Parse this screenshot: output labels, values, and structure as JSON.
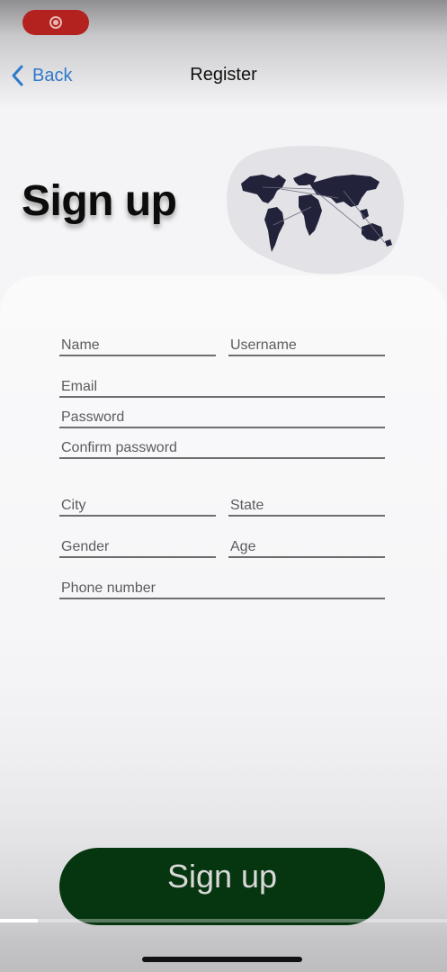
{
  "status": {
    "recording_icon": "screen-record-icon",
    "pill_color": "#b3221f"
  },
  "nav": {
    "back_label": "Back",
    "back_icon": "chevron-left-icon",
    "title": "Register",
    "accent": "#2f79c9"
  },
  "hero": {
    "title": "Sign up",
    "illustration": "world-map-illustration"
  },
  "form": {
    "name_placeholder": "Name",
    "username_placeholder": "Username",
    "email_placeholder": "Email",
    "password_placeholder": "Password",
    "confirm_password_placeholder": "Confirm password",
    "city_placeholder": "City",
    "state_placeholder": "State",
    "gender_placeholder": "Gender",
    "age_placeholder": "Age",
    "phone_placeholder": "Phone number"
  },
  "submit": {
    "label": "Sign up",
    "color": "#06360f"
  },
  "video_progress": 0.085
}
